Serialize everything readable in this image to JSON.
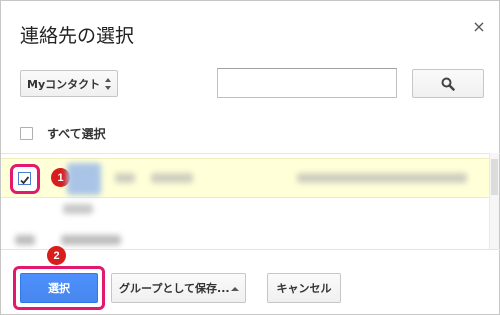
{
  "dialog": {
    "title": "連絡先の選択",
    "close_icon": "close-icon",
    "close_glyph": "×"
  },
  "toolbar": {
    "group_select": {
      "value": "Myコンタクト",
      "icon": "updown-arrows-icon"
    },
    "search": {
      "value": "",
      "placeholder": "",
      "button_icon": "search-icon"
    }
  },
  "select_all": {
    "label": "すべて選択",
    "checked": false
  },
  "contacts": [
    {
      "checked": true,
      "highlighted": true,
      "annotation": "1"
    },
    {
      "checked": false,
      "highlighted": false
    },
    {
      "checked": false,
      "highlighted": false
    }
  ],
  "footer": {
    "select_label": "選択",
    "select_annotation": "2",
    "group_save_label": "グループとして保存...",
    "cancel_label": "キャンセル"
  },
  "colors": {
    "accent_blue": "#4d90fe",
    "highlight_pink": "#e2196f",
    "badge_red": "#d81d1d",
    "selected_row": "#ffffd8"
  }
}
